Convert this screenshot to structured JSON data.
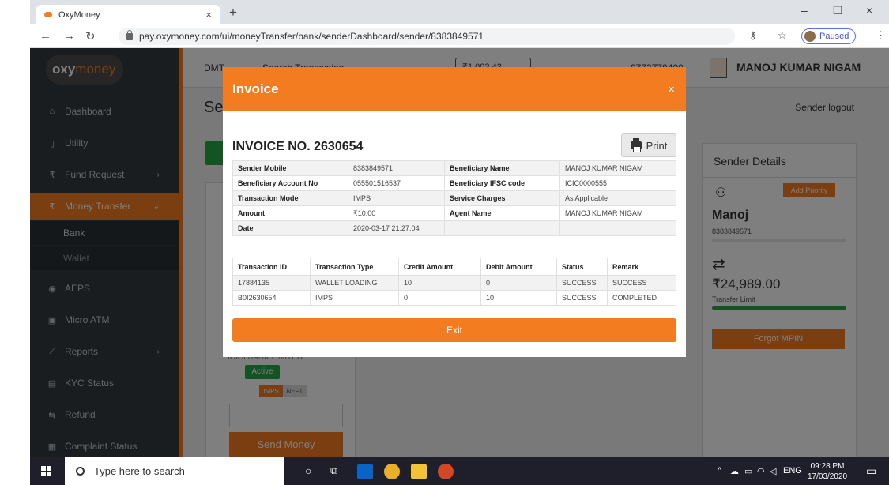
{
  "browser": {
    "tab_title": "OxyMoney",
    "tab_close": "×",
    "new_tab": "+",
    "url": "pay.oxymoney.com/ui/moneyTransfer/bank/senderDashboard/sender/8383849571",
    "profile_status": "Paused",
    "minimize": "–",
    "restore": "❐",
    "close": "×"
  },
  "sidebar": {
    "logo_oxy": "oxy",
    "logo_money": "money",
    "items": [
      {
        "label": "Dashboard",
        "icon": "home-icon",
        "glyph": "⌂"
      },
      {
        "label": "Utility",
        "icon": "mobile-icon",
        "glyph": "▯"
      },
      {
        "label": "Fund Request",
        "icon": "rupee-icon",
        "glyph": "₹",
        "chevron": "›"
      },
      {
        "label": "Money Transfer",
        "icon": "rupee-icon",
        "glyph": "₹",
        "chevron": "⌄"
      },
      {
        "label": "AEPS",
        "icon": "fingerprint-icon",
        "glyph": "◉"
      },
      {
        "label": "Micro ATM",
        "icon": "atm-icon",
        "glyph": "▣"
      },
      {
        "label": "Reports",
        "icon": "chart-icon",
        "glyph": "⟋",
        "chevron": "›"
      },
      {
        "label": "KYC Status",
        "icon": "id-card-icon",
        "glyph": "▤"
      },
      {
        "label": "Refund",
        "icon": "refund-icon",
        "glyph": "⇆"
      },
      {
        "label": "Complaint Status",
        "icon": "message-icon",
        "glyph": "▦"
      }
    ],
    "sub_items": [
      "Bank",
      "Wallet"
    ]
  },
  "topbar": {
    "dmt": "DMT",
    "search": "Search Transaction",
    "wallet": "₹1,003.42",
    "phone": "9773778400",
    "user_name": "MANOJ KUMAR NIGAM"
  },
  "page": {
    "title_partial": "Sen",
    "sender_logout": "Sender logout"
  },
  "beneficiary_card": {
    "bank_name": "ICICI BANK LIMITED",
    "status": "Active",
    "mode_imps": "IMPS",
    "mode_neft": "NEFT",
    "send_money": "Send Money"
  },
  "sender_details": {
    "title": "Sender Details",
    "add_priority": "Add Priority",
    "name": "Manoj",
    "mobile": "8383849571",
    "amount": "₹24,989.00",
    "limit_label": "Transfer Limit",
    "forgot_mpin": "Forgot MPIN"
  },
  "modal": {
    "title": "Invoice",
    "close": "×",
    "invoice_no": "INVOICE NO. 2630654",
    "print": "Print",
    "details": [
      {
        "k1": "Sender Mobile",
        "v1": "8383849571",
        "k2": "Beneficiary Name",
        "v2": "MANOJ KUMAR NIGAM"
      },
      {
        "k1": "Beneficiary Account No",
        "v1": "055501516537",
        "k2": "Beneficiary IFSC code",
        "v2": "ICIC0000555"
      },
      {
        "k1": "Transaction Mode",
        "v1": "IMPS",
        "k2": "Service Charges",
        "v2": "As Applicable"
      },
      {
        "k1": "Amount",
        "v1": "₹10.00",
        "k2": "Agent Name",
        "v2": "MANOJ KUMAR NIGAM"
      },
      {
        "k1": "Date",
        "v1": "2020-03-17 21:27:04",
        "k2": "",
        "v2": ""
      }
    ],
    "tx_headers": [
      "Transaction ID",
      "Transaction Type",
      "Credit Amount",
      "Debit Amount",
      "Status",
      "Remark"
    ],
    "tx_rows": [
      [
        "17884135",
        "WALLET LOADING",
        "10",
        "0",
        "SUCCESS",
        "SUCCESS"
      ],
      [
        "B0I2630654",
        "IMPS",
        "0",
        "10",
        "SUCCESS",
        "COMPLETED"
      ]
    ],
    "exit": "Exit"
  },
  "taskbar": {
    "search_placeholder": "Type here to search",
    "lang": "ENG",
    "time": "09:28 PM",
    "date": "17/03/2020"
  },
  "colors": {
    "brand_orange": "#f47c20",
    "sidebar_bg": "#343a40",
    "success_green": "#28a745"
  }
}
